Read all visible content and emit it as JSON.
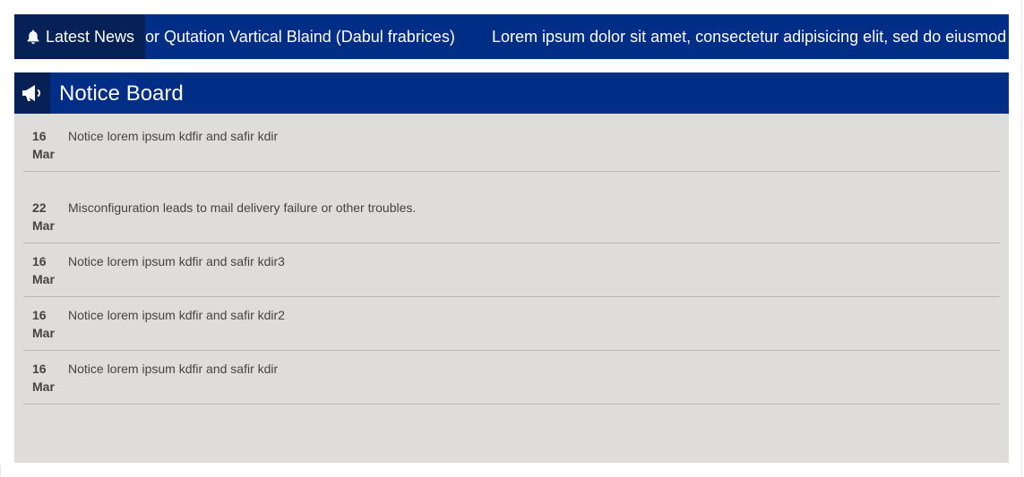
{
  "ticker": {
    "label": "Latest News",
    "items": [
      "or Qutation Vartical Blaind (Dabul frabrices)",
      "Lorem ipsum dolor sit amet, consectetur adipisicing elit, sed do eiusmod"
    ]
  },
  "board": {
    "title": "Notice Board",
    "notices": [
      {
        "day": "16",
        "month": "Mar",
        "text": "Notice lorem ipsum kdfir and safir kdir"
      },
      {
        "day": "22",
        "month": "Mar",
        "text": "Misconfiguration leads to mail delivery failure or other troubles."
      },
      {
        "day": "16",
        "month": "Mar",
        "text": "Notice lorem ipsum kdfir and safir kdir3"
      },
      {
        "day": "16",
        "month": "Mar",
        "text": "Notice lorem ipsum kdfir and safir kdir2"
      },
      {
        "day": "16",
        "month": "Mar",
        "text": "Notice lorem ipsum kdfir and safir kdir"
      }
    ]
  },
  "colors": {
    "primary": "#002e86",
    "primary_dark": "#052155",
    "board_bg": "#dedddc"
  },
  "icons": {
    "ticker": "bell-icon",
    "board": "megaphone-icon"
  }
}
